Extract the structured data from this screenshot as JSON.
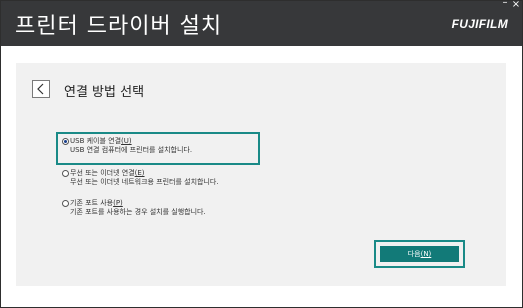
{
  "window": {
    "title": "프린터 드라이버 설치",
    "brand": "FUJIFILM",
    "minimize_glyph": "–",
    "close_glyph": "×"
  },
  "page": {
    "heading": "연결 방법 선택",
    "back_icon": "chevron-left-icon"
  },
  "options": [
    {
      "label": "USB 케이블 연결",
      "shortcut": "(U)",
      "description": "USB 연결 컴퓨터에 프린터를 설치합니다.",
      "selected": true
    },
    {
      "label": "무선 또는 이더넷 연결",
      "shortcut": "(E)",
      "description": "무선 또는 이더넷 네트워크용 프린터를 설치합니다.",
      "selected": false
    },
    {
      "label": "기존 포트 사용",
      "shortcut": "(P)",
      "description": "기존 포트를 사용하는 경우 설치를 실행합니다.",
      "selected": false
    }
  ],
  "buttons": {
    "next_label": "다음",
    "next_shortcut": "(N)"
  },
  "colors": {
    "titlebar": "#37383a",
    "accent": "#1a8a87",
    "button": "#127a78",
    "content_bg": "#f1f1f1"
  }
}
